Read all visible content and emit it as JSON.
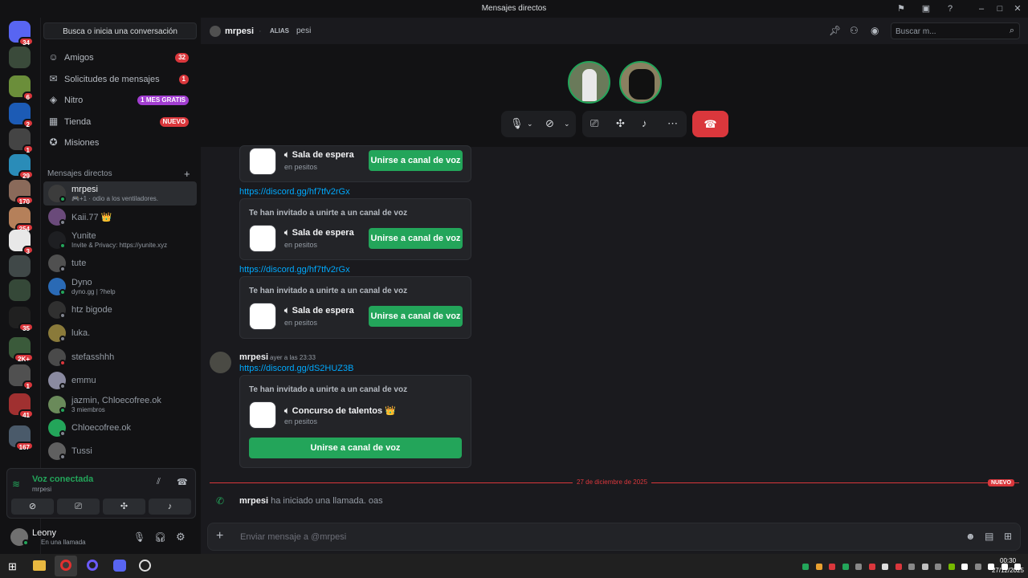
{
  "window": {
    "title": "Mensajes directos"
  },
  "guilds": [
    {
      "badge": "34",
      "color": "#5865f2"
    },
    {
      "badge": "",
      "color": "#3a4a3a"
    },
    {
      "badge": "6",
      "color": "#6b8e3a"
    },
    {
      "badge": "2",
      "color": "#1c5bb5"
    },
    {
      "badge": "1",
      "color": "#444"
    },
    {
      "badge": "29",
      "color": "#2a8cb8"
    },
    {
      "badge": "170",
      "color": "#8a6a5a"
    },
    {
      "badge": "254",
      "color": "#b5805a"
    },
    {
      "badge": "3",
      "color": "#e8e8e8"
    },
    {
      "badge": "",
      "color": "#404848"
    },
    {
      "badge": "",
      "color": "#354838"
    },
    {
      "badge": "35",
      "color": "#202020"
    },
    {
      "badge": "2K+",
      "color": "#3a5a3a"
    },
    {
      "badge": "1",
      "color": "#505050"
    },
    {
      "badge": "41",
      "color": "#a03030"
    },
    {
      "badge": "167",
      "color": "#4a5a6a"
    }
  ],
  "search": {
    "label": "Busca o inicia una conversación"
  },
  "nav": [
    {
      "label": "Amigos",
      "badge": "32",
      "badge_color": "#da373c",
      "icon": "wave-icon"
    },
    {
      "label": "Solicitudes de mensajes",
      "badge": "1",
      "badge_color": "#da373c",
      "icon": "envelope-icon"
    },
    {
      "label": "Nitro",
      "badge": "1 MES GRATIS",
      "badge_color": "#a23ed1",
      "icon": "nitro-icon"
    },
    {
      "label": "Tienda",
      "badge": "NUEVO",
      "badge_color": "#da373c",
      "icon": "shop-icon"
    },
    {
      "label": "Misiones",
      "badge": "",
      "badge_color": "",
      "icon": "quest-icon"
    }
  ],
  "dm_header": "Mensajes directos",
  "dms": [
    {
      "name": "mrpesi",
      "sub": "🎮+1 · odio a los ventiladores.",
      "status": "#23a55a",
      "active": true,
      "color": "#3c3c3c"
    },
    {
      "name": "Kaii.77 👑",
      "sub": "",
      "status": "#80848e",
      "active": false,
      "color": "#6a4a7a"
    },
    {
      "name": "Yunite",
      "sub": "Invite & Privacy: https://yunite.xyz",
      "status": "#23a55a",
      "active": false,
      "color": "#1e1f22"
    },
    {
      "name": "tute",
      "sub": "",
      "status": "#80848e",
      "active": false,
      "color": "#505050"
    },
    {
      "name": "Dyno",
      "sub": "dyno.gg | ?help",
      "status": "#23a55a",
      "active": false,
      "color": "#2a6ab5"
    },
    {
      "name": "htz bigode",
      "sub": "",
      "status": "#80848e",
      "active": false,
      "color": "#303030"
    },
    {
      "name": "luka.",
      "sub": "",
      "status": "#80848e",
      "active": false,
      "color": "#8a7a3a"
    },
    {
      "name": "stefasshhh",
      "sub": "",
      "status": "#da373c",
      "active": false,
      "color": "#4a4a4a"
    },
    {
      "name": "emmu",
      "sub": "",
      "status": "#80848e",
      "active": false,
      "color": "#8a8aa0"
    },
    {
      "name": "jazmin, Chloecofree.ok",
      "sub": "3 miembros",
      "status": "#23a55a",
      "active": false,
      "color": "#6a8a5a"
    },
    {
      "name": "Chloecofree.ok",
      "sub": "",
      "status": "#80848e",
      "active": false,
      "color": "#23a55a"
    },
    {
      "name": "Tussi",
      "sub": "",
      "status": "#80848e",
      "active": false,
      "color": "#606060"
    }
  ],
  "voice": {
    "status": "Voz conectada",
    "channel": "mrpesi"
  },
  "user": {
    "name": "Leony",
    "status": "En una llamada"
  },
  "header": {
    "name": "mrpesi",
    "alias_label": "ALIAS",
    "alias": "pesi",
    "search_placeholder": "Buscar m..."
  },
  "invites": [
    {
      "header": "",
      "channel": "Sala de espera",
      "server": "en pesitos",
      "button": "Unirse a canal de voz"
    },
    {
      "link": "https://discord.gg/hf7tfv2rGx",
      "header": "Te han invitado a unirte a un canal de voz",
      "channel": "Sala de espera",
      "server": "en pesitos",
      "button": "Unirse a canal de voz"
    },
    {
      "link": "https://discord.gg/hf7tfv2rGx",
      "header": "Te han invitado a unirte a un canal de voz",
      "channel": "Sala de espera",
      "server": "en pesitos",
      "button": "Unirse a canal de voz"
    }
  ],
  "message": {
    "author": "mrpesi",
    "time": "ayer a las 23:33",
    "link": "https://discord.gg/dS2HUZ3B",
    "invite": {
      "header": "Te han invitado a unirte a un canal de voz",
      "channel": "Concurso de talentos 👑",
      "server": "en pesitos",
      "button": "Unirse a canal de voz"
    }
  },
  "divider": {
    "date": "27 de diciembre de 2025",
    "badge": "NUEVO"
  },
  "system": {
    "author": "mrpesi",
    "text": "ha iniciado una llamada. oas"
  },
  "composer": {
    "placeholder": "Enviar mensaje a @mrpesi"
  },
  "clock": {
    "time": "00:30",
    "date": "27/12/2025"
  }
}
